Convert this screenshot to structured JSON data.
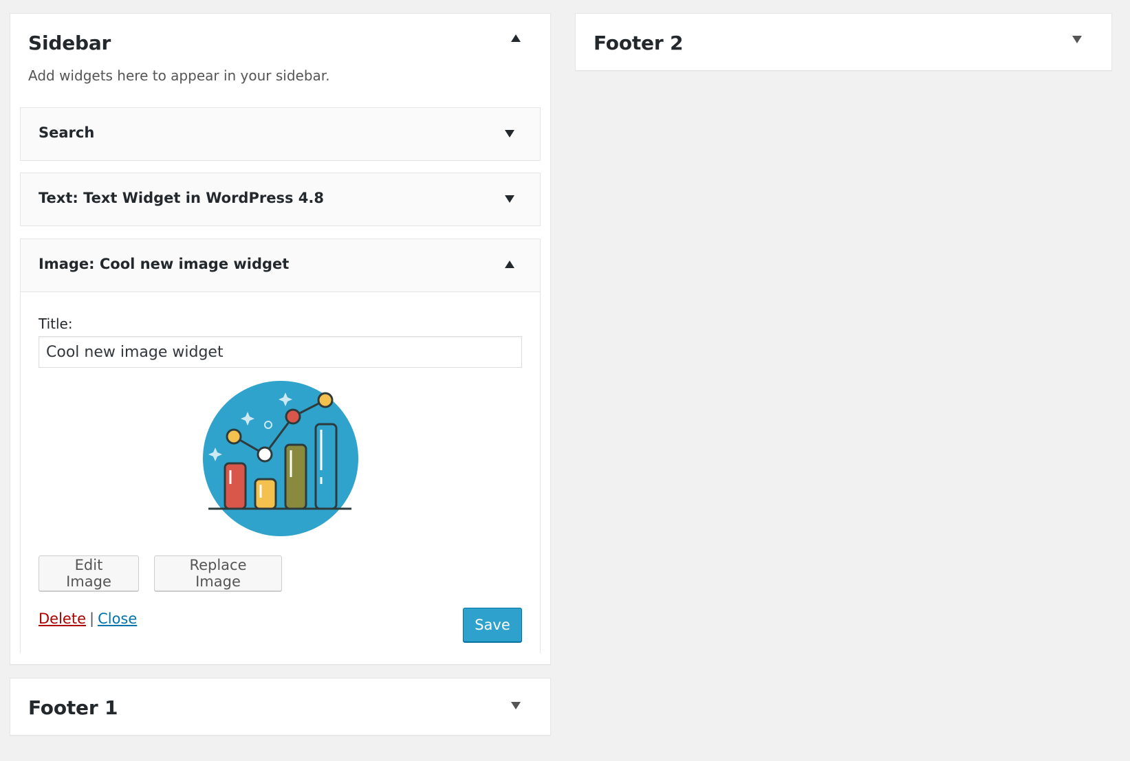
{
  "sidebar_area": {
    "title": "Sidebar",
    "description": "Add widgets here to appear in your sidebar."
  },
  "widgets": [
    {
      "title": "Search"
    },
    {
      "title": "Text: Text Widget in WordPress 4.8"
    },
    {
      "title": "Image: Cool new image widget"
    }
  ],
  "image_widget": {
    "title_label": "Title:",
    "title_value": "Cool new image widget",
    "edit_button": "Edit Image",
    "replace_button": "Replace Image",
    "delete_link": "Delete",
    "separator": "|",
    "close_link": "Close",
    "save_button": "Save",
    "image_icon": "bar-chart-illustration"
  },
  "footer1": {
    "title": "Footer 1"
  },
  "footer2": {
    "title": "Footer 2"
  },
  "colors": {
    "background": "#f1f1f1",
    "primary_button": "#2ea2cc",
    "delete_link": "#aa0000",
    "close_link": "#0073aa",
    "illustration_circle": "#2fa3cc"
  }
}
